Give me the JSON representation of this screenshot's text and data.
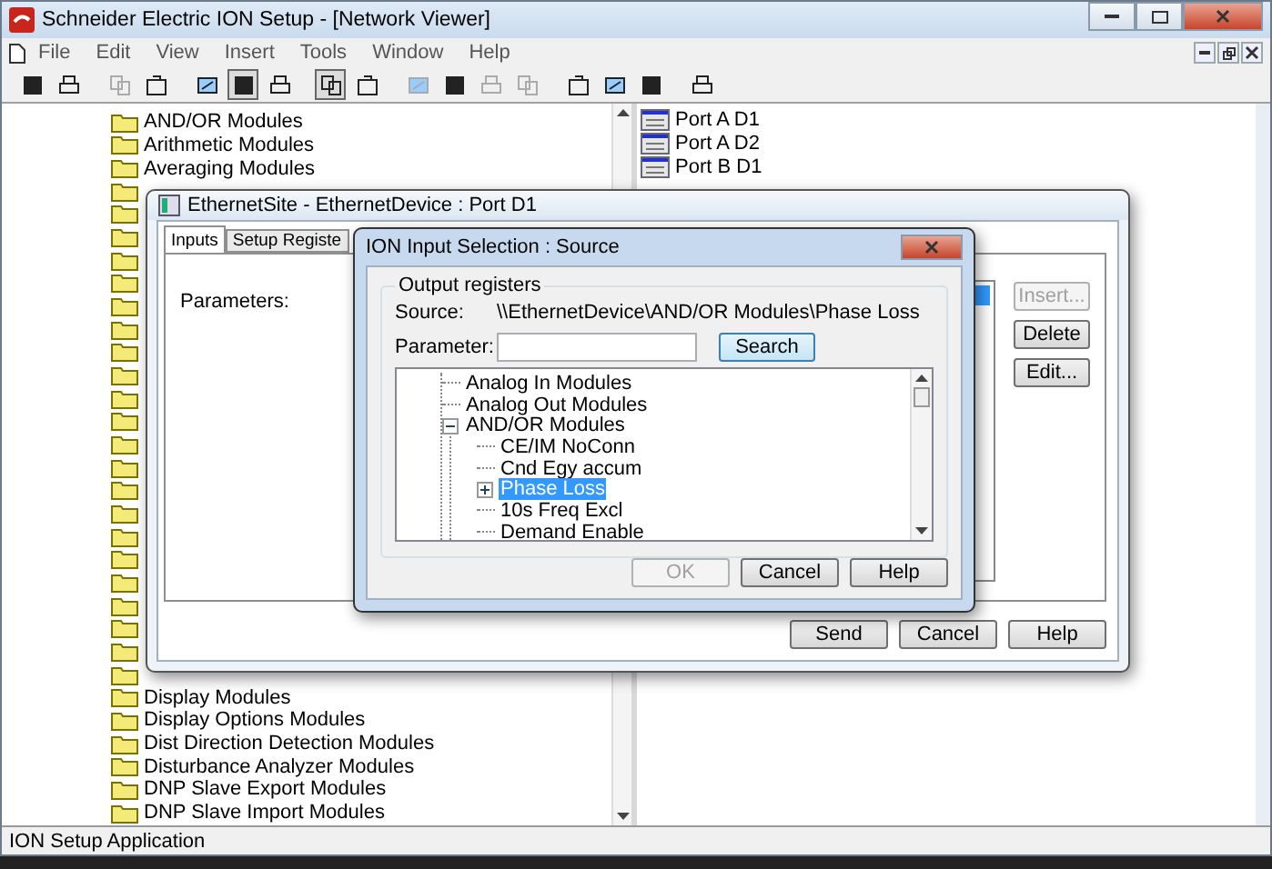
{
  "window": {
    "title": "Schneider Electric ION Setup - [Network Viewer]"
  },
  "menu": [
    "File",
    "Edit",
    "View",
    "Insert",
    "Tools",
    "Window",
    "Help"
  ],
  "toolbar": [
    {
      "pressed": false,
      "disabled": false
    },
    {
      "pressed": false,
      "disabled": false
    },
    {
      "pressed": false,
      "disabled": true
    },
    {
      "pressed": false,
      "disabled": false
    },
    {
      "pressed": false,
      "disabled": false
    },
    {
      "pressed": true,
      "disabled": false
    },
    {
      "pressed": false,
      "disabled": false
    },
    {
      "pressed": true,
      "disabled": false
    },
    {
      "pressed": false,
      "disabled": false
    },
    {
      "pressed": false,
      "disabled": true
    },
    {
      "pressed": false,
      "disabled": false
    },
    {
      "pressed": false,
      "disabled": true
    },
    {
      "pressed": false,
      "disabled": true
    },
    {
      "pressed": false,
      "disabled": false
    },
    {
      "pressed": false,
      "disabled": false
    },
    {
      "pressed": false,
      "disabled": false
    },
    {
      "pressed": false,
      "disabled": false
    }
  ],
  "tree_top": [
    "AND/OR Modules",
    "Arithmetic Modules",
    "Averaging Modules"
  ],
  "tree_bottom": [
    "Display Modules",
    "Display Options Modules",
    "Dist Direction Detection Modules",
    "Disturbance Analyzer Modules",
    "DNP Slave Export Modules",
    "DNP Slave Import Modules"
  ],
  "ports": [
    "Port A D1",
    "Port A D2",
    "Port B D1"
  ],
  "device_window": {
    "title": "EthernetSite - EthernetDevice : Port D1",
    "tabs": [
      {
        "label": "Inputs",
        "selected": true
      },
      {
        "label": "Setup Registe",
        "selected": false
      }
    ],
    "parameters_label": "Parameters:",
    "side_buttons": [
      {
        "label": "Insert...",
        "disabled": true
      },
      {
        "label": "Delete",
        "disabled": false
      },
      {
        "label": "Edit...",
        "disabled": false
      }
    ],
    "bottom_buttons": [
      {
        "label": "Send"
      },
      {
        "label": "Cancel"
      },
      {
        "label": "Help"
      }
    ]
  },
  "dialog": {
    "title": "ION Input Selection : Source",
    "group": "Output registers",
    "source_label": "Source:",
    "source": "\\\\EthernetDevice\\AND/OR Modules\\Phase Loss",
    "parameter_label": "Parameter:",
    "search": "Search",
    "tree": [
      {
        "label": "Analog In Modules",
        "selected": false
      },
      {
        "label": "Analog Out Modules",
        "selected": false
      },
      {
        "label": "AND/OR Modules",
        "selected": false,
        "expanded": true,
        "children": [
          {
            "label": "CE/IM NoConn",
            "selected": false
          },
          {
            "label": "Cnd Egy accum",
            "selected": false
          },
          {
            "label": "Phase Loss",
            "selected": true,
            "expanded": false
          },
          {
            "label": "10s Freq Excl",
            "selected": false
          },
          {
            "label": "Demand Enable",
            "selected": false
          }
        ]
      }
    ],
    "buttons": [
      {
        "label": "OK",
        "disabled": true
      },
      {
        "label": "Cancel",
        "disabled": false
      },
      {
        "label": "Help",
        "disabled": false
      }
    ]
  },
  "status_bar": "ION Setup Application"
}
